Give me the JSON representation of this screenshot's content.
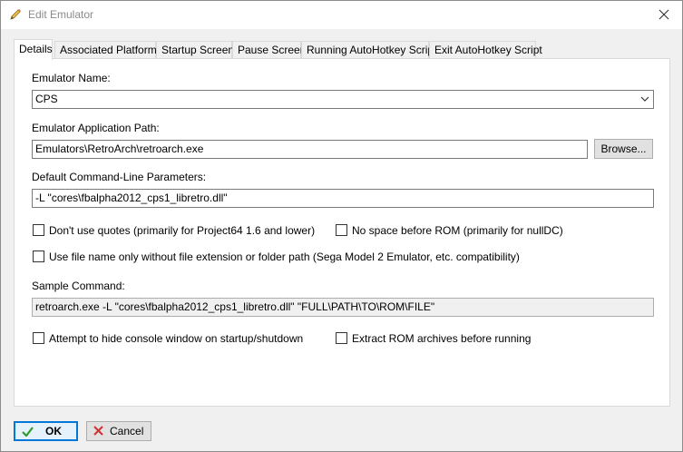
{
  "window": {
    "title": "Edit Emulator"
  },
  "tabs": [
    {
      "label": "Details",
      "active": true
    },
    {
      "label": "Associated Platforms"
    },
    {
      "label": "Startup Screen"
    },
    {
      "label": "Pause Screen"
    },
    {
      "label": "Running AutoHotkey Script"
    },
    {
      "label": "Exit AutoHotkey Script"
    }
  ],
  "details": {
    "emulator_name_label": "Emulator Name:",
    "emulator_name_value": "CPS",
    "app_path_label": "Emulator Application Path:",
    "app_path_value": "Emulators\\RetroArch\\retroarch.exe",
    "browse_label": "Browse...",
    "params_label": "Default Command-Line Parameters:",
    "params_value": "-L \"cores\\fbalpha2012_cps1_libretro.dll\"",
    "dont_use_quotes_label": "Don't use quotes (primarily for Project64 1.6 and lower)",
    "no_space_label": "No space before ROM (primarily for nullDC)",
    "file_name_only_label": "Use file name only without file extension or folder path (Sega Model 2 Emulator, etc. compatibility)",
    "sample_command_label": "Sample Command:",
    "sample_command_value": "retroarch.exe -L \"cores\\fbalpha2012_cps1_libretro.dll\" \"FULL\\PATH\\TO\\ROM\\FILE\"",
    "hide_console_label": "Attempt to hide console window on startup/shutdown",
    "extract_rom_label": "Extract ROM archives before running",
    "checkboxes": {
      "dont_use_quotes": false,
      "no_space": false,
      "file_name_only": false,
      "hide_console": false,
      "extract_rom": false
    }
  },
  "buttons": {
    "ok": "OK",
    "cancel": "Cancel"
  },
  "colors": {
    "accent": "#0078d7",
    "ok_check": "#2e9b2e",
    "cancel_x": "#d03030"
  }
}
